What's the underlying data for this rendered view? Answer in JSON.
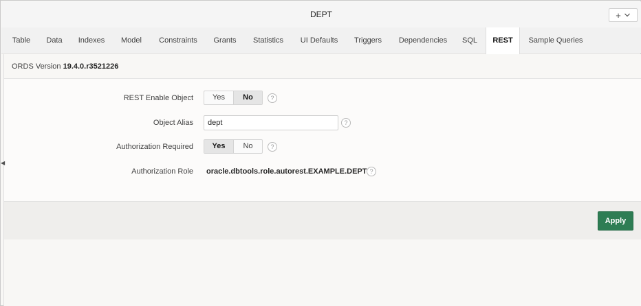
{
  "window": {
    "title": "DEPT"
  },
  "add_menu": {
    "plus": "+"
  },
  "tabs": [
    {
      "label": "Table"
    },
    {
      "label": "Data"
    },
    {
      "label": "Indexes"
    },
    {
      "label": "Model"
    },
    {
      "label": "Constraints"
    },
    {
      "label": "Grants"
    },
    {
      "label": "Statistics"
    },
    {
      "label": "UI Defaults"
    },
    {
      "label": "Triggers"
    },
    {
      "label": "Dependencies"
    },
    {
      "label": "SQL"
    },
    {
      "label": "REST",
      "active": true
    },
    {
      "label": "Sample Queries"
    }
  ],
  "ords": {
    "label": "ORDS Version",
    "value": "19.4.0.r3521226"
  },
  "form": {
    "rest_enable": {
      "label": "REST Enable Object",
      "yes": "Yes",
      "no": "No",
      "selected": "No"
    },
    "object_alias": {
      "label": "Object Alias",
      "value": "dept"
    },
    "auth_required": {
      "label": "Authorization Required",
      "yes": "Yes",
      "no": "No",
      "selected": "Yes"
    },
    "auth_role": {
      "label": "Authorization Role",
      "value": "oracle.dbtools.role.autorest.EXAMPLE.DEPT"
    },
    "help_glyph": "?"
  },
  "actions": {
    "apply_label": "Apply",
    "apply_color": "#2e7d54"
  },
  "collapse_glyph": "◀"
}
